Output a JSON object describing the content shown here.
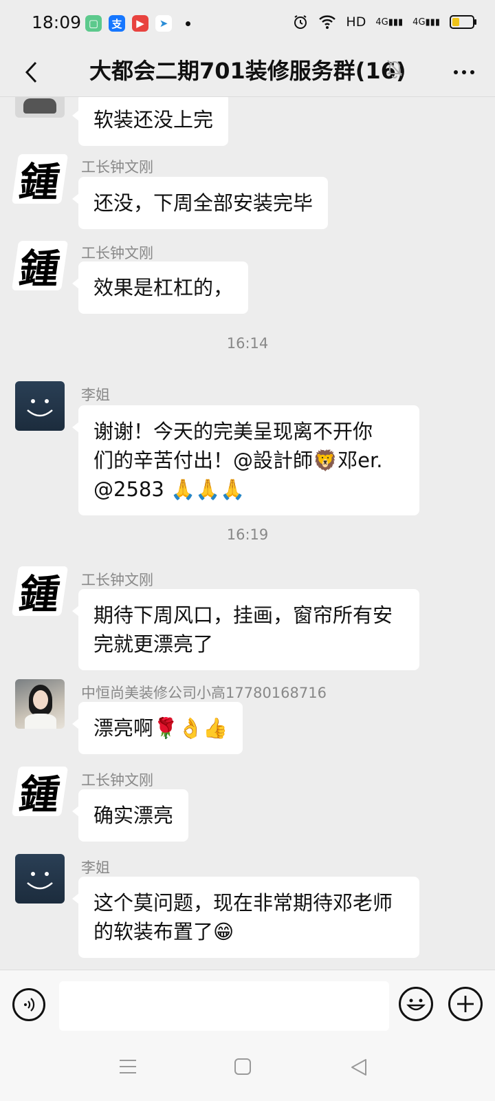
{
  "status_bar": {
    "time": "18:09",
    "network_label": "HD",
    "signal1": "4G",
    "signal2": "4G",
    "battery_level": 0.3
  },
  "nav": {
    "title": "大都会二期701装修服务群(16)"
  },
  "messages": [
    {
      "sender": "",
      "text": "软装还没上完"
    },
    {
      "sender": "工长钟文刚",
      "text": "还没，下周全部安装完毕"
    },
    {
      "sender": "工长钟文刚",
      "text": "效果是杠杠的，"
    },
    {
      "sender": "李姐",
      "line1": "谢谢！今天的完美呈现离不开你",
      "line2": "们的辛苦付出！@設計師🦁邓er.",
      "line3": "@2583 🙏🙏🙏"
    },
    {
      "sender": "工长钟文刚",
      "line1": "期待下周风口，挂画，窗帘所有安",
      "line2": "完就更漂亮了"
    },
    {
      "sender": "中恒尚美装修公司小高17780168716",
      "text": "漂亮啊🌹👌👍"
    },
    {
      "sender": "工长钟文刚",
      "text": "确实漂亮"
    },
    {
      "sender": "李姐",
      "line1": "这个莫问题，现在非常期待邓老师",
      "line2": "的软装布置了😁"
    }
  ],
  "timestamps": [
    "16:14",
    "16:19"
  ],
  "avatar_glyph": "鍾",
  "input": {
    "placeholder": ""
  }
}
